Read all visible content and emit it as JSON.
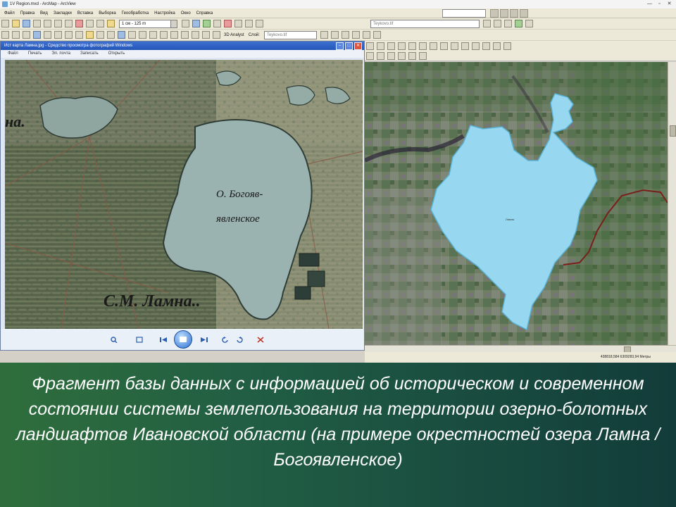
{
  "titlebar": {
    "title": "1V Region.mxd - ArcMap - ArcView"
  },
  "menu": [
    "Файл",
    "Правка",
    "Вид",
    "Закладки",
    "Вставка",
    "Выборка",
    "Геообработка",
    "Настройка",
    "Окно",
    "Справка"
  ],
  "toolbar": {
    "scale_value": "1 см - 125 m",
    "analyst_label": "3D Analyst",
    "layer_label": "Слой:",
    "layer_value": "Teykovo.tif",
    "layer2_value": "Teykovo.tif"
  },
  "viewer": {
    "title": "Ист карта Ламна.jpg - Средство просмотра фотографий Windows",
    "menu": [
      "Файл",
      "Печать",
      "Эл. почта",
      "Записать",
      "Открыть"
    ],
    "oldmap_labels": {
      "top_left": "на.",
      "lake_name_line1": "О. Богояв-",
      "lake_name_line2": "явленское",
      "village": "С.М. Ламна.."
    }
  },
  "rightmap": {
    "lake_label": "Ламна"
  },
  "statusbar": {
    "coords": "438818,584  6309283,94 Метры"
  },
  "caption": {
    "text": "Фрагмент базы данных с информацией об историческом и современном состоянии системы землепользования на территории озерно-болотных ландшафтов Ивановской области (на примере окрестностей озера Ламна / Богоявленское)"
  },
  "colors": {
    "lake_fill": "#97d7ef",
    "boundary_line": "#7a1f1a",
    "caption_bg": "#205c44"
  }
}
